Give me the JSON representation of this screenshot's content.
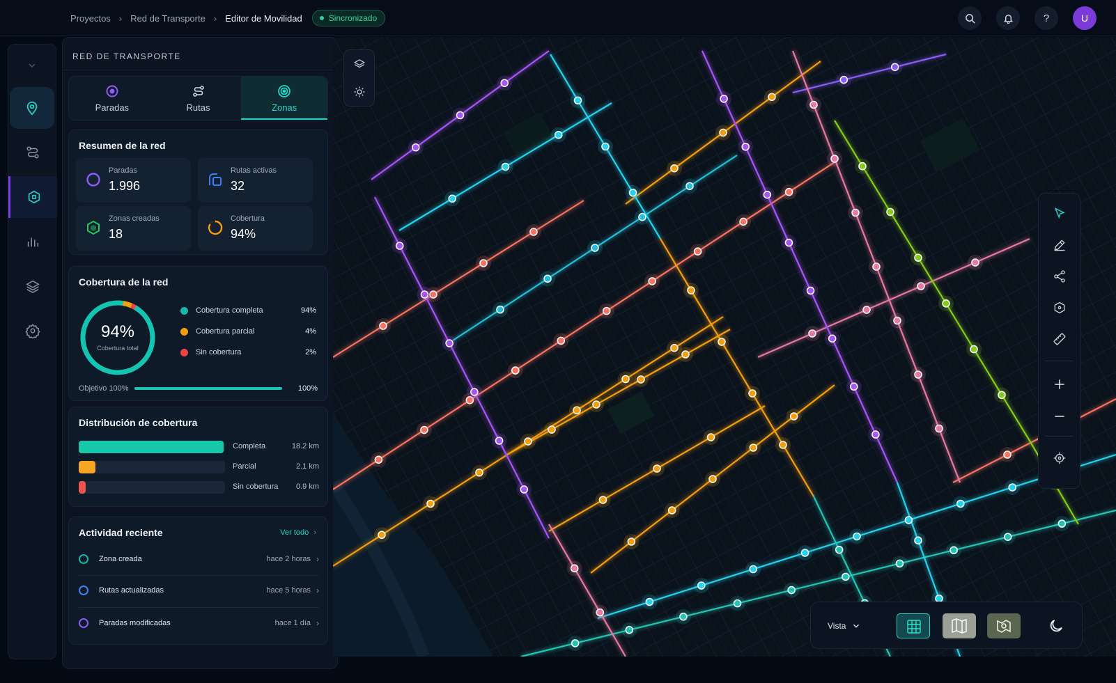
{
  "breadcrumb": {
    "items": [
      "Proyectos",
      "Red de Transporte",
      "Editor de Movilidad"
    ],
    "sync_status": "Sincronizado"
  },
  "user": {
    "initial": "U"
  },
  "topbar_icons": [
    "search-icon",
    "bell-icon",
    "help-icon"
  ],
  "rail": {
    "items": [
      "location-pin-icon",
      "routes-icon",
      "zones-icon",
      "analytics-icon",
      "layers-icon",
      "settings-icon"
    ],
    "selected": "location-pin-icon",
    "active": "zones-icon"
  },
  "panel": {
    "title": "RED DE TRANSPORTE",
    "tabs": [
      {
        "label": "Paradas",
        "icon": "stop-icon"
      },
      {
        "label": "Rutas",
        "icon": "route-icon"
      },
      {
        "label": "Zonas",
        "icon": "target-icon",
        "selected": true
      }
    ]
  },
  "summary": {
    "title": "Resumen de la red",
    "stats": [
      {
        "label": "Paradas",
        "value": "1.996",
        "icon": "stop-ring-icon",
        "color": "#8b5cf6"
      },
      {
        "label": "Rutas activas",
        "value": "32",
        "icon": "route-square-icon",
        "color": "#3b82f6"
      },
      {
        "label": "Zonas creadas",
        "value": "18",
        "icon": "hexagon-icon",
        "color": "#22c55e"
      },
      {
        "label": "Cobertura",
        "value": "94%",
        "icon": "progress-ring-icon",
        "color": "#f59e0b"
      }
    ]
  },
  "coverage": {
    "title": "Cobertura de la red",
    "donut_value": "94%",
    "donut_caption": "Cobertura total",
    "legend": [
      {
        "label": "Cobertura completa",
        "value": "94%",
        "color": "#14b8a6"
      },
      {
        "label": "Cobertura parcial",
        "value": "4%",
        "color": "#f59e0b"
      },
      {
        "label": "Sin cobertura",
        "value": "2%",
        "color": "#ef4444"
      }
    ],
    "objective_label": "Objetivo 100%",
    "objective_value": "100%",
    "objective_progress": 1.0
  },
  "distribution": {
    "title": "Distribución de cobertura",
    "rows": [
      {
        "label": "Completa",
        "value": "18.2 km",
        "km": 18.2,
        "color": "#16c7a9"
      },
      {
        "label": "Parcial",
        "value": "2.1 km",
        "km": 2.1,
        "color": "#f5a623"
      },
      {
        "label": "Sin cobertura",
        "value": "0.9 km",
        "km": 0.9,
        "color": "#ef5350"
      }
    ]
  },
  "activity": {
    "title": "Actividad reciente",
    "see_all": "Ver todo",
    "items": [
      {
        "label": "Zona creada",
        "time": "hace 2 horas",
        "color": "#14b8a6"
      },
      {
        "label": "Rutas actualizadas",
        "time": "hace 5 horas",
        "color": "#3b82f6"
      },
      {
        "label": "Paradas modificadas",
        "time": "hace 1 día",
        "color": "#8b5cf6"
      }
    ]
  },
  "map": {
    "left_tools": [
      "layers-icon",
      "brightness-icon"
    ],
    "right_tools": [
      "select-cursor-icon",
      "pencil-icon",
      "share-nodes-icon",
      "zone-hexagon-icon",
      "ruler-icon",
      "zoom-in-icon",
      "zoom-out-icon",
      "locate-icon"
    ],
    "view_label": "Vista",
    "view_modes": [
      "grid-map-view",
      "map-view",
      "satellite-view"
    ],
    "selected_view": "grid-map-view",
    "theme_icon": "moon-icon"
  }
}
